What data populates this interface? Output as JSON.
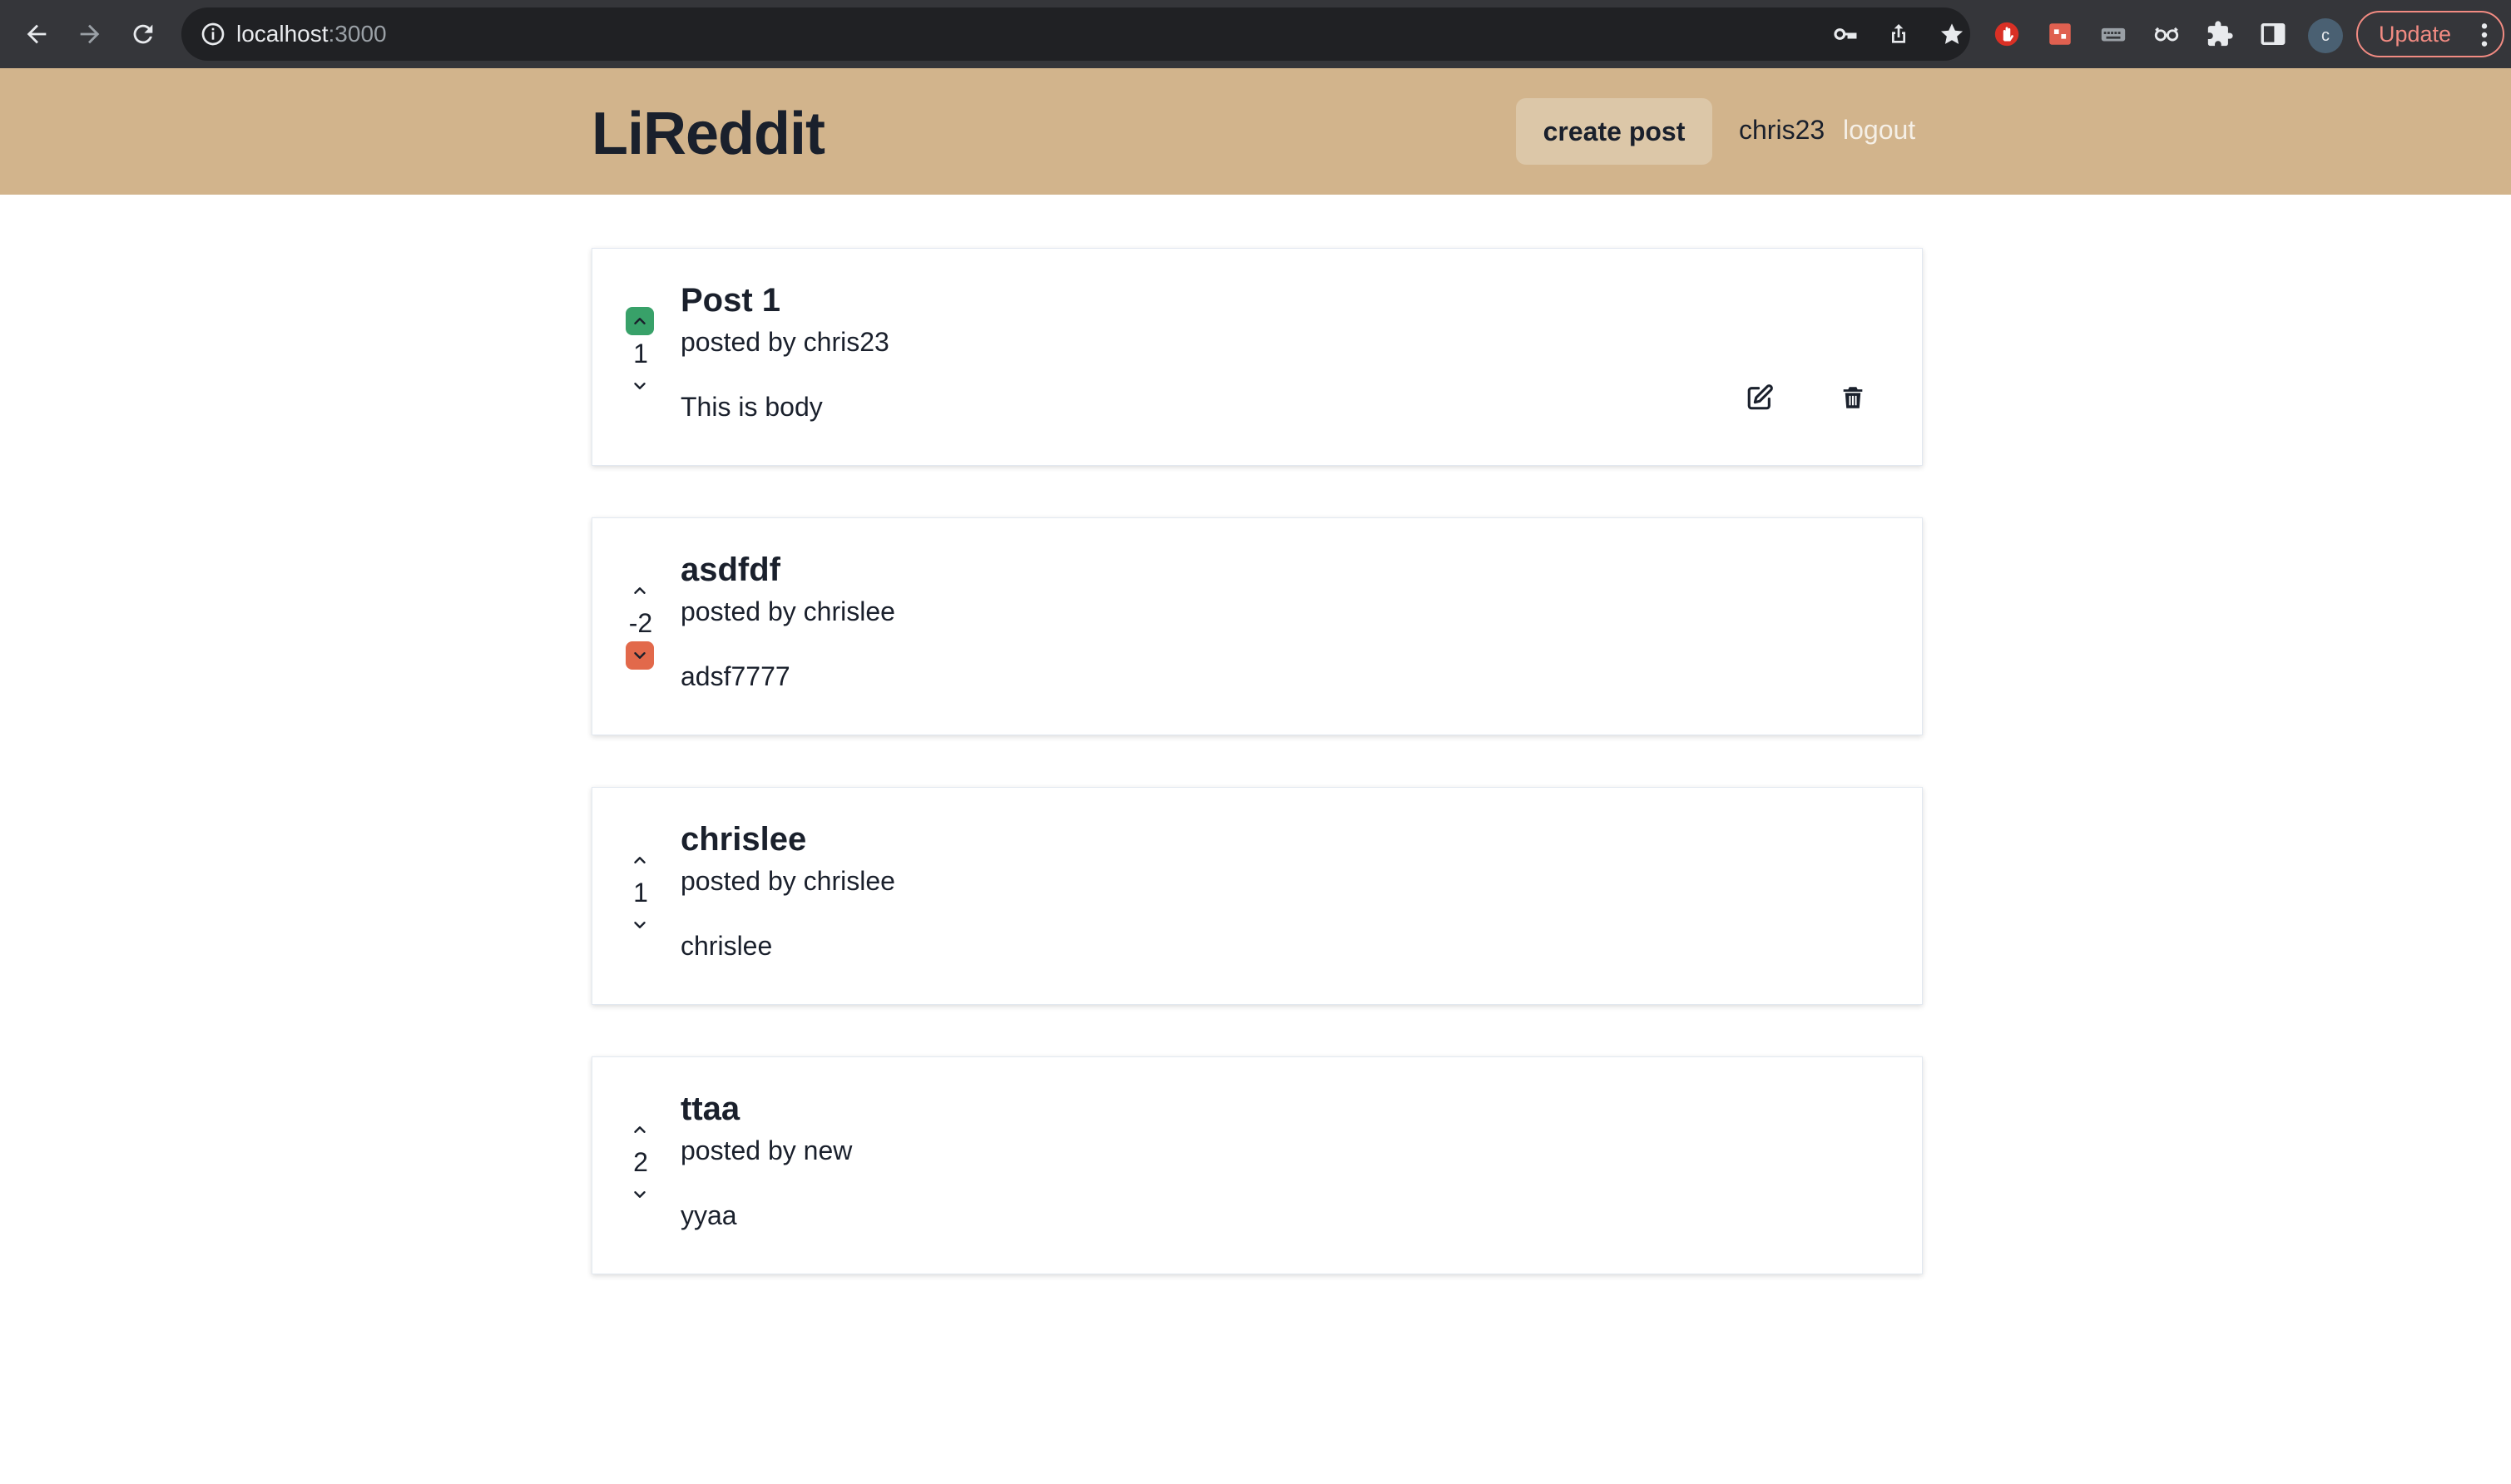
{
  "browser": {
    "url_host": "localhost",
    "url_port": ":3000",
    "profile_initial": "c",
    "update_label": "Update"
  },
  "navbar": {
    "logo": "LiReddit",
    "create_post_label": "create post",
    "username": "chris23",
    "logout_label": "logout",
    "background_color": "#d2b48c"
  },
  "posts": [
    {
      "title": "Post 1",
      "author_line": "posted by chris23",
      "body": "This is body",
      "points": "1",
      "vote_state": "up",
      "can_edit": true
    },
    {
      "title": "asdfdf",
      "author_line": "posted by chrislee",
      "body": "adsf7777",
      "points": "-2",
      "vote_state": "down",
      "can_edit": false
    },
    {
      "title": "chrislee",
      "author_line": "posted by chrislee",
      "body": "chrislee",
      "points": "1",
      "vote_state": "none",
      "can_edit": false
    },
    {
      "title": "ttaa",
      "author_line": "posted by new",
      "body": "yyaa",
      "points": "2",
      "vote_state": "none",
      "can_edit": false
    }
  ],
  "colors": {
    "upvote_active": "#38a169",
    "downvote_active": "#e2694b"
  },
  "icons": {
    "upvote": "chevron-up-icon",
    "downvote": "chevron-down-icon",
    "edit": "edit-icon",
    "delete": "trash-icon"
  }
}
